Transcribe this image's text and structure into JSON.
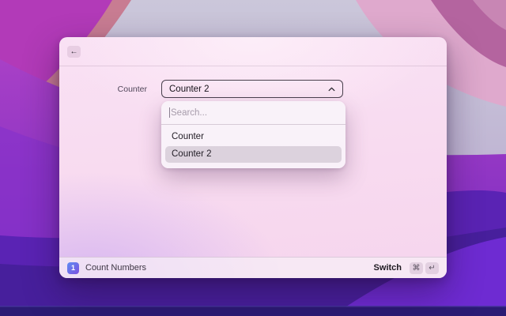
{
  "colors": {
    "accent-icon-start": "#5f8df2",
    "accent-icon-end": "#7b4fe0",
    "selection-bg": "rgba(120,100,125,0.22)"
  },
  "window": {
    "header": {
      "back_icon": "←"
    },
    "form": {
      "field_label": "Counter",
      "select": {
        "value": "Counter 2"
      }
    },
    "dropdown": {
      "search": {
        "placeholder": "Search...",
        "value": ""
      },
      "options": [
        {
          "label": "Counter",
          "selected": false
        },
        {
          "label": "Counter 2",
          "selected": true
        }
      ]
    },
    "footer": {
      "app_icon_text": "1",
      "command_name": "Count Numbers",
      "action_label": "Switch",
      "shortcut_keys": [
        "⌘",
        "↵"
      ]
    }
  }
}
